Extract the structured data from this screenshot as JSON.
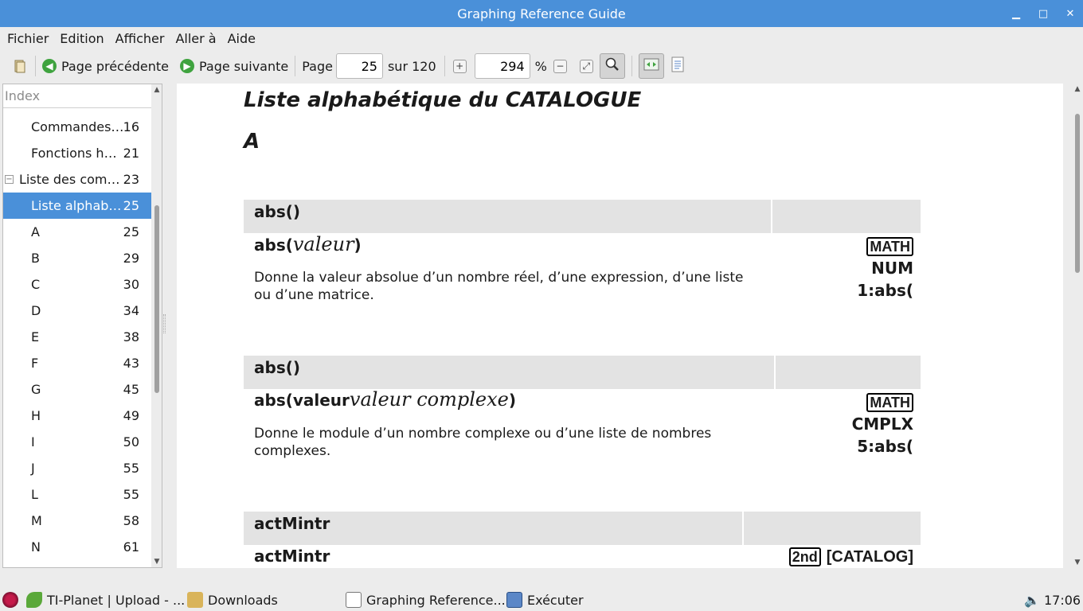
{
  "window": {
    "title": "Graphing Reference Guide"
  },
  "menu": [
    "Fichier",
    "Edition",
    "Afficher",
    "Aller à",
    "Aide"
  ],
  "toolbar": {
    "prev_label": "Page précédente",
    "next_label": "Page suivante",
    "page_label": "Page",
    "page_value": "25",
    "of_label": "sur 120",
    "zoom_value": "294",
    "zoom_unit": "%"
  },
  "sidebar": {
    "search_placeholder": "Index",
    "items": [
      {
        "label": "Commandes…",
        "page": "16"
      },
      {
        "label": "Fonctions h…",
        "page": "21"
      },
      {
        "label": "Liste des com…",
        "page": "23"
      },
      {
        "label": "Liste alphab…",
        "page": "25"
      },
      {
        "label": "A",
        "page": "25"
      },
      {
        "label": "B",
        "page": "29"
      },
      {
        "label": "C",
        "page": "30"
      },
      {
        "label": "D",
        "page": "34"
      },
      {
        "label": "E",
        "page": "38"
      },
      {
        "label": "F",
        "page": "43"
      },
      {
        "label": "G",
        "page": "45"
      },
      {
        "label": "H",
        "page": "49"
      },
      {
        "label": "I",
        "page": "50"
      },
      {
        "label": "J",
        "page": "55"
      },
      {
        "label": "L",
        "page": "55"
      },
      {
        "label": "M",
        "page": "58"
      },
      {
        "label": "N",
        "page": "61"
      }
    ]
  },
  "document": {
    "title": "Liste alphabétique du CATALOGUE",
    "letter": "A",
    "entries": [
      {
        "name": "abs()",
        "syntax_fn": "abs(",
        "syntax_arg": "valeur",
        "syntax_close": ")",
        "description": "Donne la valeur absolue d’un nombre réel, d’une expression, d’une liste ou d’une matrice.",
        "key": "MATH",
        "key_line2": "NUM",
        "key_line3": "1:abs("
      },
      {
        "name": "abs()",
        "syntax_fn": "abs(valeur",
        "syntax_arg": "valeur complexe",
        "syntax_close": ")",
        "description": "Donne le module d’un nombre complexe ou d’une liste de nombres complexes.",
        "key": "MATH",
        "key_line2": "CMPLX",
        "key_line3": "5:abs("
      },
      {
        "name": "actMintr",
        "syntax_fn": "actMintr",
        "key": "2nd",
        "key_bracket": "[CATALOG]"
      }
    ]
  },
  "taskbar": {
    "items": [
      {
        "label": "TI-Planet | Upload - ..."
      },
      {
        "label": "Downloads"
      },
      {
        "label": "Graphing Reference..."
      },
      {
        "label": "Exécuter"
      }
    ],
    "clock": "17:06"
  },
  "colors": {
    "titlebar": "#4a90d9",
    "selection": "#4a90d9",
    "accent_green": "#3fa33f"
  }
}
